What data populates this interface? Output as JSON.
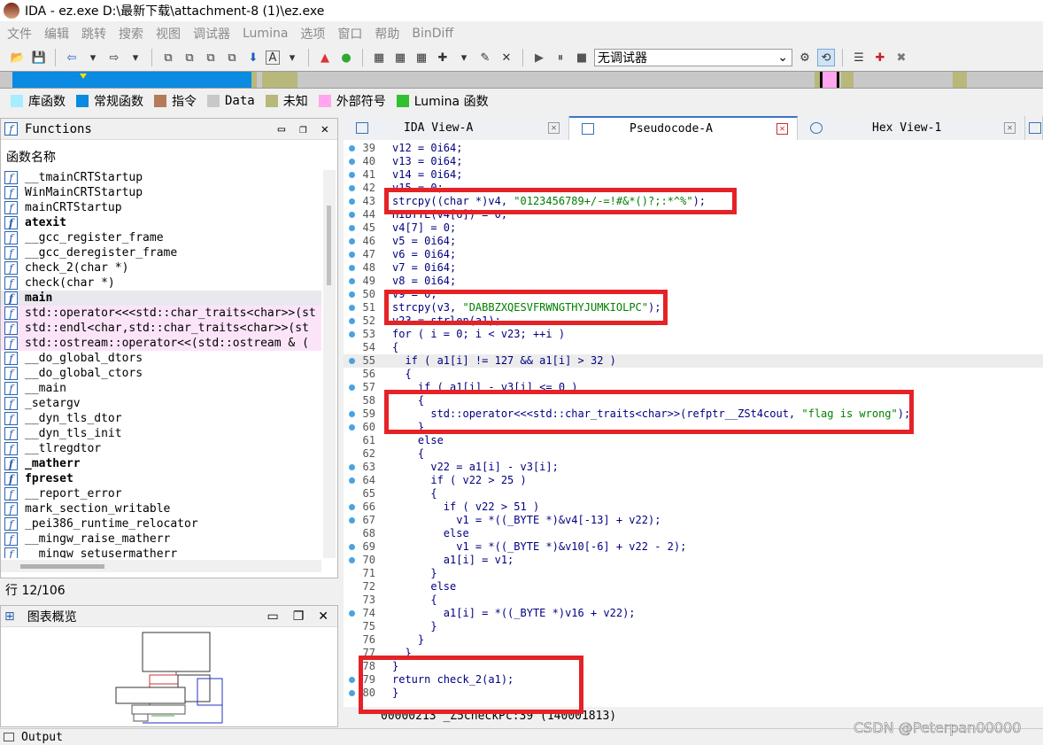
{
  "window": {
    "title": "IDA - ez.exe D:\\最新下载\\attachment-8 (1)\\ez.exe"
  },
  "menu": [
    "文件",
    "编辑",
    "跳转",
    "搜索",
    "视图",
    "调试器",
    "Lumina",
    "选项",
    "窗口",
    "帮助",
    "BinDiff"
  ],
  "toolbar": {
    "debugger_select": "无调试器"
  },
  "legend": [
    {
      "label": "库函数",
      "color": "#a6eeff"
    },
    {
      "label": "常规函数",
      "color": "#0a8ae0"
    },
    {
      "label": "指令",
      "color": "#b47a5a"
    },
    {
      "label": "Data",
      "color": "#c8c8c8"
    },
    {
      "label": "未知",
      "color": "#b8b87a"
    },
    {
      "label": "外部符号",
      "color": "#ffa6ee"
    },
    {
      "label": "Lumina 函数",
      "color": "#30c030"
    }
  ],
  "functions_panel": {
    "title": "Functions",
    "column": "函数名称",
    "items": [
      {
        "name": "__tmainCRTStartup"
      },
      {
        "name": "WinMainCRTStartup"
      },
      {
        "name": "mainCRTStartup"
      },
      {
        "name": "atexit",
        "bold": true
      },
      {
        "name": "__gcc_register_frame"
      },
      {
        "name": "__gcc_deregister_frame"
      },
      {
        "name": "check_2(char *)"
      },
      {
        "name": "check(char *)"
      },
      {
        "name": "main",
        "bold": true,
        "selected": true
      },
      {
        "name": "std::operator<<<std::char_traits<char>>(st",
        "pink": true
      },
      {
        "name": "std::endl<char,std::char_traits<char>>(st",
        "pink": true
      },
      {
        "name": "std::ostream::operator<<(std::ostream & (",
        "pink": true
      },
      {
        "name": "__do_global_dtors"
      },
      {
        "name": "__do_global_ctors"
      },
      {
        "name": "__main"
      },
      {
        "name": "_setargv"
      },
      {
        "name": "__dyn_tls_dtor"
      },
      {
        "name": "__dyn_tls_init"
      },
      {
        "name": "__tlregdtor"
      },
      {
        "name": "_matherr",
        "bold": true
      },
      {
        "name": "fpreset",
        "bold": true
      },
      {
        "name": "__report_error"
      },
      {
        "name": "mark_section_writable"
      },
      {
        "name": "_pei386_runtime_relocator"
      },
      {
        "name": "__mingw_raise_matherr"
      },
      {
        "name": "__mingw_setusermatherr"
      }
    ],
    "row_count": "行 12/106"
  },
  "graph_panel": {
    "title": "图表概览"
  },
  "output_label": "Output",
  "tabs": [
    {
      "label": "IDA View-A",
      "active": false
    },
    {
      "label": "Pseudocode-A",
      "active": true
    },
    {
      "label": "Hex View-1",
      "active": false
    }
  ],
  "code_lines": [
    {
      "n": "39",
      "dot": true,
      "t": "v12 = 0i64;"
    },
    {
      "n": "40",
      "dot": true,
      "t": "v13 = 0i64;"
    },
    {
      "n": "41",
      "dot": true,
      "t": "v14 = 0i64;"
    },
    {
      "n": "42",
      "dot": true,
      "t": "v15 = 0;"
    },
    {
      "n": "43",
      "dot": true,
      "t": "strcpy((char *)v4, \"0123456789+/-=!#&*()?;:*^%\");"
    },
    {
      "n": "44",
      "dot": true,
      "t": "HIBYTE(v4[6]) = 0;"
    },
    {
      "n": "45",
      "dot": true,
      "t": "v4[7] = 0;"
    },
    {
      "n": "46",
      "dot": true,
      "t": "v5 = 0i64;"
    },
    {
      "n": "47",
      "dot": true,
      "t": "v6 = 0i64;"
    },
    {
      "n": "48",
      "dot": true,
      "t": "v7 = 0i64;"
    },
    {
      "n": "49",
      "dot": true,
      "t": "v8 = 0i64;"
    },
    {
      "n": "50",
      "dot": true,
      "t": "v9 = 0;"
    },
    {
      "n": "51",
      "dot": true,
      "t": "strcpy(v3, \"DABBZXQESVFRWNGTHYJUMKIOLPC\");"
    },
    {
      "n": "52",
      "dot": true,
      "t": "v23 = strlen(a1);"
    },
    {
      "n": "53",
      "dot": true,
      "t": "for ( i = 0; i < v23; ++i )"
    },
    {
      "n": "54",
      "dot": false,
      "t": "{"
    },
    {
      "n": "55",
      "dot": true,
      "t": "  if ( a1[i] != 127 && a1[i] > 32 )",
      "hl": true
    },
    {
      "n": "56",
      "dot": false,
      "t": "  {"
    },
    {
      "n": "57",
      "dot": true,
      "t": "    if ( a1[i] - v3[i] <= 0 )"
    },
    {
      "n": "58",
      "dot": false,
      "t": "    {"
    },
    {
      "n": "59",
      "dot": true,
      "t": "      std::operator<<<std::char_traits<char>>(refptr__ZSt4cout, \"flag is wrong\");"
    },
    {
      "n": "60",
      "dot": true,
      "t": "    }"
    },
    {
      "n": "61",
      "dot": false,
      "t": "    else"
    },
    {
      "n": "62",
      "dot": false,
      "t": "    {"
    },
    {
      "n": "63",
      "dot": true,
      "t": "      v22 = a1[i] - v3[i];"
    },
    {
      "n": "64",
      "dot": true,
      "t": "      if ( v22 > 25 )"
    },
    {
      "n": "65",
      "dot": false,
      "t": "      {"
    },
    {
      "n": "66",
      "dot": true,
      "t": "        if ( v22 > 51 )"
    },
    {
      "n": "67",
      "dot": true,
      "t": "          v1 = *((_BYTE *)&v4[-13] + v22);"
    },
    {
      "n": "68",
      "dot": false,
      "t": "        else"
    },
    {
      "n": "69",
      "dot": true,
      "t": "          v1 = *((_BYTE *)&v10[-6] + v22 - 2);"
    },
    {
      "n": "70",
      "dot": true,
      "t": "        a1[i] = v1;"
    },
    {
      "n": "71",
      "dot": false,
      "t": "      }"
    },
    {
      "n": "72",
      "dot": false,
      "t": "      else"
    },
    {
      "n": "73",
      "dot": false,
      "t": "      {"
    },
    {
      "n": "74",
      "dot": true,
      "t": "        a1[i] = *((_BYTE *)v16 + v22);"
    },
    {
      "n": "75",
      "dot": false,
      "t": "      }"
    },
    {
      "n": "76",
      "dot": false,
      "t": "    }"
    },
    {
      "n": "77",
      "dot": false,
      "t": "  }"
    },
    {
      "n": "78",
      "dot": false,
      "t": "}"
    },
    {
      "n": "79",
      "dot": true,
      "t": "return check_2(a1);"
    },
    {
      "n": "80",
      "dot": true,
      "t": "}"
    }
  ],
  "status_text": "00000213 _Z5checkPc:39 (140001813)",
  "watermark": "CSDN @Peterpan00000"
}
